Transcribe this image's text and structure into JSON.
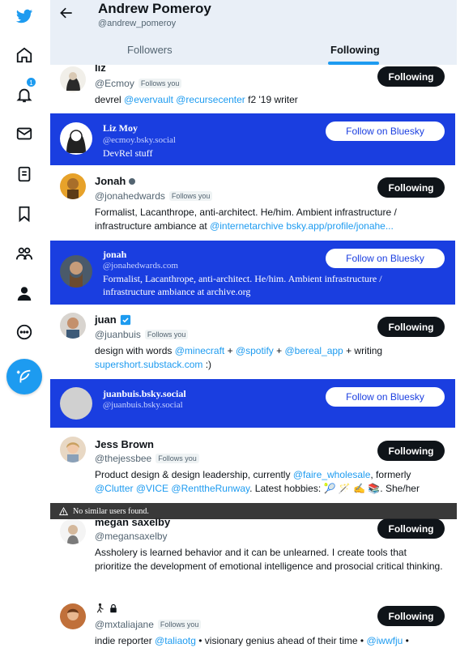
{
  "nav": {
    "notification_count": "1"
  },
  "header": {
    "name": "Andrew Pomeroy",
    "handle": "@andrew_pomeroy",
    "tabs": [
      "Followers",
      "Following"
    ]
  },
  "follows_you_label": "Follows you",
  "following_label": "Following",
  "bluesky_button_label": "Follow on Bluesky",
  "toast": "No similar users found.",
  "users": [
    {
      "name": "liz",
      "handle": "@Ecmoy",
      "follows_you": true,
      "bio": [
        {
          "t": "devrel "
        },
        {
          "t": "@evervault",
          "m": true
        },
        {
          "t": " "
        },
        {
          "t": "@recursecenter",
          "m": true
        },
        {
          "t": " f2 '19 writer"
        }
      ]
    },
    {
      "name": "Jonah",
      "handle": "@jonahedwards",
      "follows_you": true,
      "bio": [
        {
          "t": "Formalist, Lacanthrope, anti-architect. He/him. Ambient infrastructure / infrastructure ambiance at "
        },
        {
          "t": "@internetarchive",
          "m": true
        },
        {
          "t": " "
        },
        {
          "t": "bsky.app/profile/jonahe...",
          "m": true
        }
      ]
    },
    {
      "name": "juan",
      "handle": "@juanbuis",
      "follows_you": true,
      "bio": [
        {
          "t": "design with words "
        },
        {
          "t": "@minecraft",
          "m": true
        },
        {
          "t": " + "
        },
        {
          "t": "@spotify",
          "m": true
        },
        {
          "t": " + "
        },
        {
          "t": "@bereal_app",
          "m": true
        },
        {
          "t": " + writing "
        },
        {
          "t": "supershort.substack.com",
          "m": true
        },
        {
          "t": " :)"
        }
      ]
    },
    {
      "name": "Jess Brown",
      "handle": "@thejessbee",
      "follows_you": true,
      "bio": [
        {
          "t": "Product design & design leadership, currently "
        },
        {
          "t": "@faire_wholesale",
          "m": true
        },
        {
          "t": ", formerly "
        },
        {
          "t": "@Clutter",
          "m": true
        },
        {
          "t": " "
        },
        {
          "t": "@VICE",
          "m": true
        },
        {
          "t": " "
        },
        {
          "t": "@RenttheRunway",
          "m": true
        },
        {
          "t": ". Latest hobbies: 🎾 🪄 ✍️ 📚. She/her"
        }
      ]
    },
    {
      "name": "megan saxelby",
      "handle": "@megansaxelby",
      "follows_you": false,
      "bio": [
        {
          "t": "Assholery is learned behavior and it can be unlearned. I create tools that prioritize the development of emotional intelligence and prosocial critical thinking."
        }
      ]
    },
    {
      "name": "",
      "handle": "@mxtaliajane",
      "follows_you": true,
      "bio": [
        {
          "t": "indie reporter "
        },
        {
          "t": "@taliaotg",
          "m": true
        },
        {
          "t": " • visionary genius ahead of their time • "
        },
        {
          "t": "@iwwfju",
          "m": true
        },
        {
          "t": " •"
        }
      ]
    }
  ],
  "bluesky": [
    {
      "name": "Liz Moy",
      "handle": "@ecmoy.bsky.social",
      "bio": "DevRel stuff"
    },
    {
      "name": "jonah",
      "handle": "@jonahedwards.com",
      "bio": "Formalist, Lacanthrope, anti-architect. He/him. Ambient infrastructure / infrastructure ambiance at archive.org"
    },
    {
      "name": "juanbuis.bsky.social",
      "handle": "@juanbuis.bsky.social",
      "bio": ""
    }
  ],
  "colors": {
    "accent": "#1d9bf0",
    "bluesky": "#1a3ee0",
    "dark": "#0f1419"
  }
}
